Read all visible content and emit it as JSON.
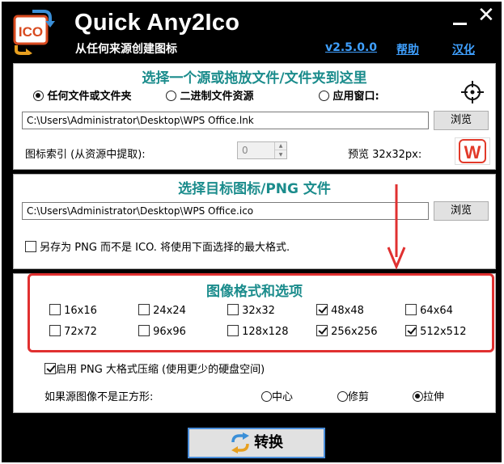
{
  "header": {
    "title": "Quick Any2Ico",
    "subtitle": "从任何来源创建图标",
    "logo_text": "ICO",
    "version": "v2.5.0.0",
    "help": "帮助",
    "localize": "汉化"
  },
  "source": {
    "heading": "选择一个源或拖放文件/文件夹到这里",
    "options": [
      "任何文件或文件夹",
      "二进制文件资源",
      "应用窗口:"
    ],
    "selected": "任何文件或文件夹",
    "path": "C:\\Users\\Administrator\\Desktop\\WPS Office.lnk",
    "browse": "浏览",
    "index_label": "图标索引 (从资源中提取):",
    "index_value": "0",
    "preview_label": "预览 32x32px:",
    "preview_icon_text": "W"
  },
  "target": {
    "heading": "选择目标图标/PNG 文件",
    "path": "C:\\Users\\Administrator\\Desktop\\WPS Office.ico",
    "browse": "浏览",
    "save_png_label": "另存为 PNG 而不是 ICO. 将使用下面选择的最大格式.",
    "save_png_checked": false
  },
  "formats": {
    "heading": "图像格式和选项",
    "items": [
      {
        "label": "16x16",
        "checked": false
      },
      {
        "label": "24x24",
        "checked": false
      },
      {
        "label": "32x32",
        "checked": false
      },
      {
        "label": "48x48",
        "checked": true
      },
      {
        "label": "64x64",
        "checked": false
      },
      {
        "label": "72x72",
        "checked": false
      },
      {
        "label": "96x96",
        "checked": false
      },
      {
        "label": "128x128",
        "checked": false
      },
      {
        "label": "256x256",
        "checked": true
      },
      {
        "label": "512x512",
        "checked": true
      }
    ],
    "compress_label": "启用 PNG 大格式压缩 (使用更少的硬盘空间)",
    "compress_checked": true,
    "nonsquare_label": "如果源图像不是正方形:",
    "nonsquare_options": [
      "中心",
      "修剪",
      "拉伸"
    ],
    "nonsquare_selected": "拉伸"
  },
  "convert_label": "转换",
  "colors": {
    "accent": "#1b8c8c",
    "link": "#3fa0ff",
    "annotation": "#e03030"
  }
}
